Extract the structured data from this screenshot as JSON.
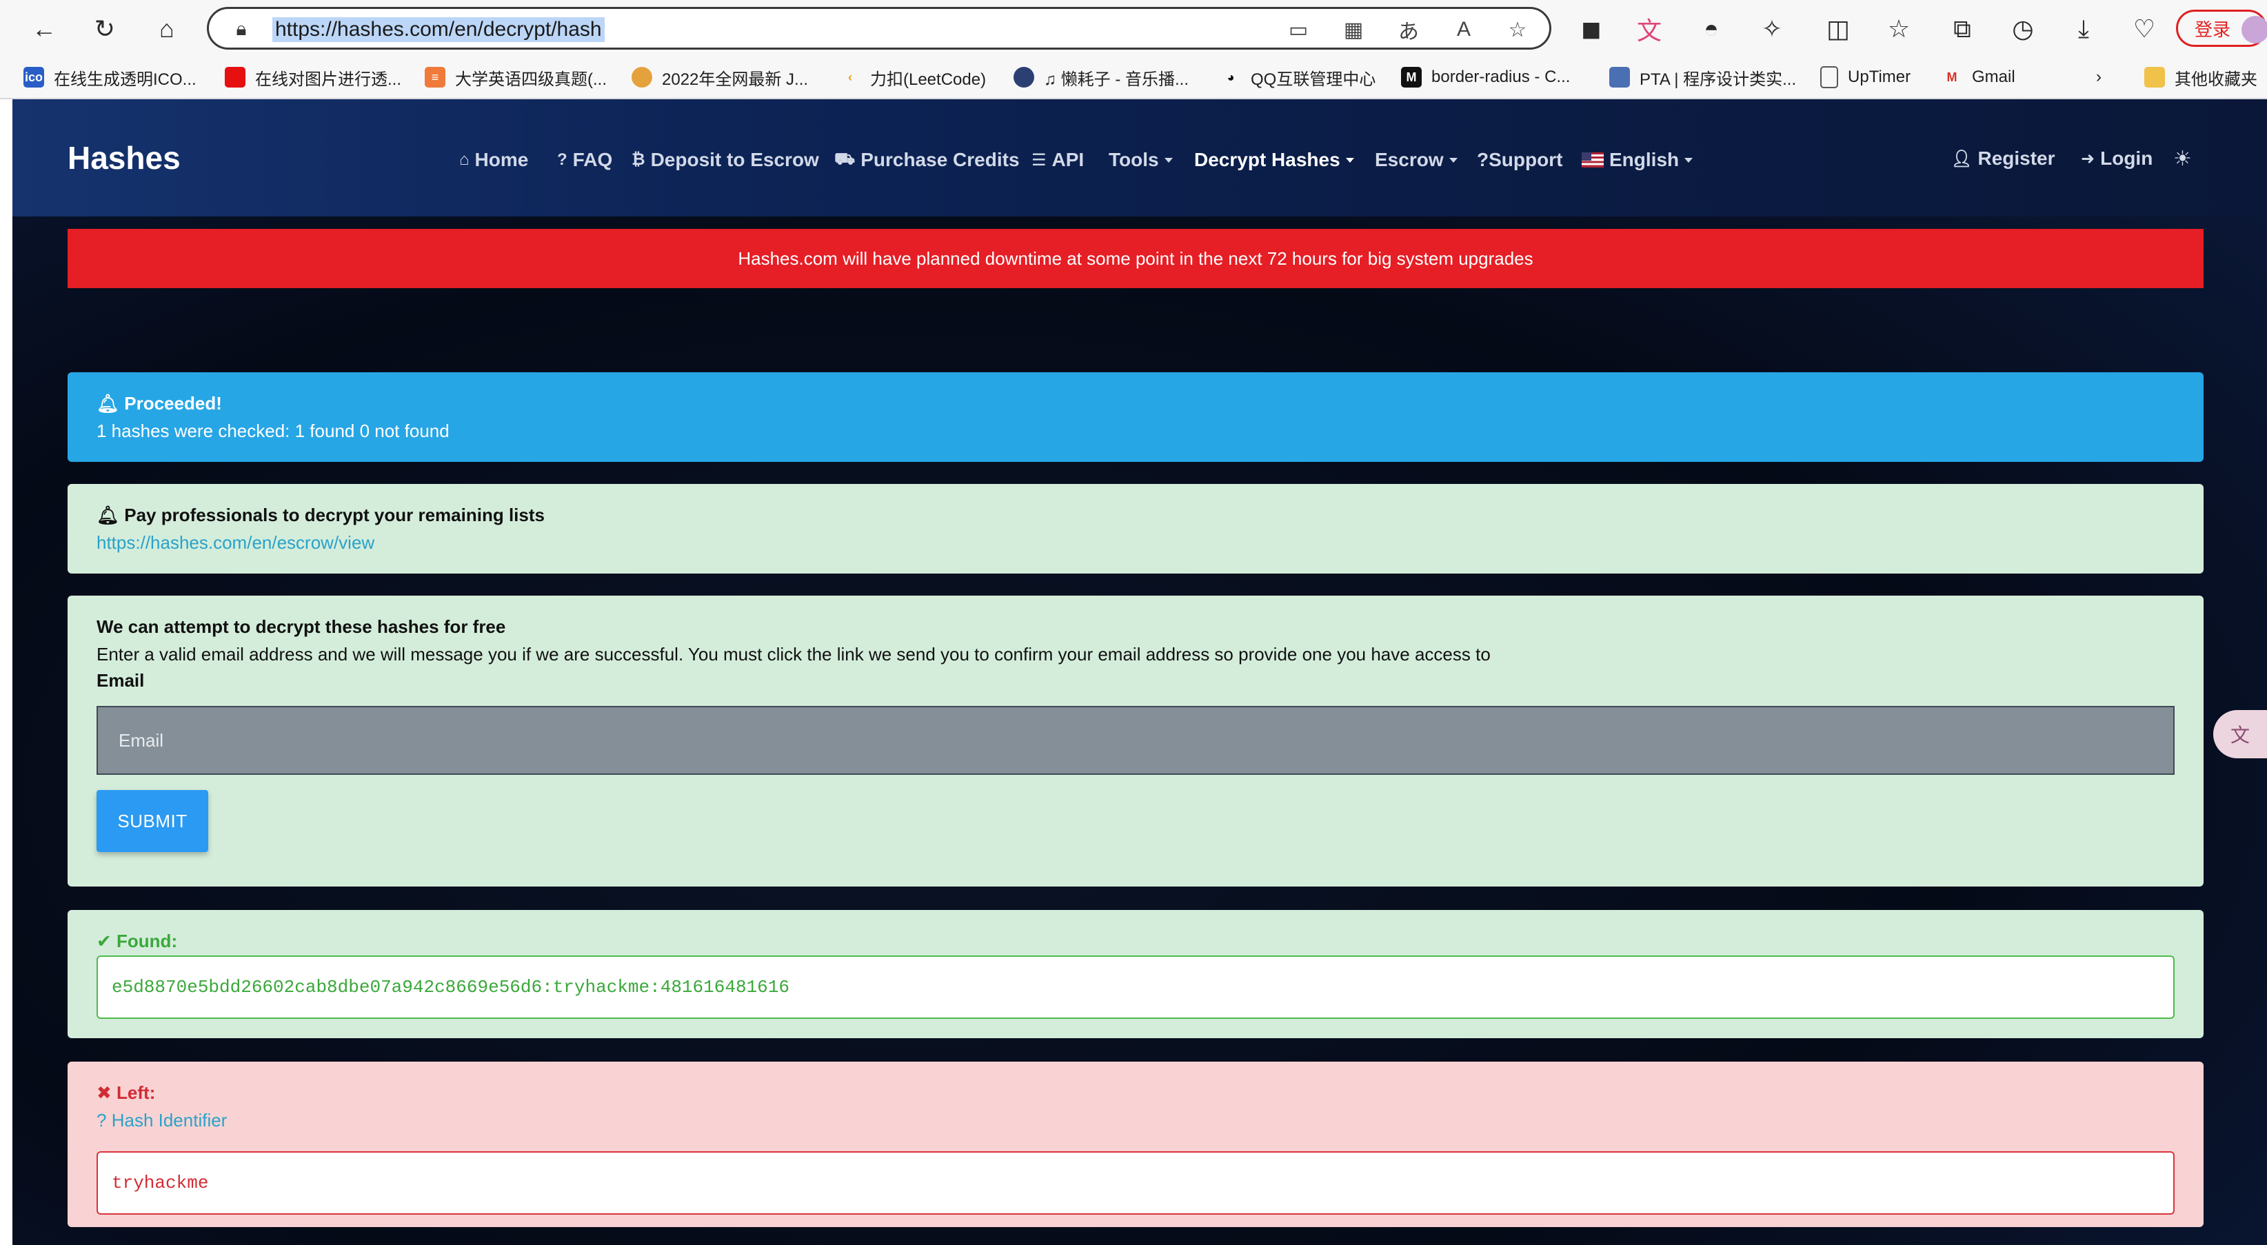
{
  "browser": {
    "url": "https://hashes.com/en/decrypt/hash",
    "login_label": "登录",
    "bookmarks": [
      {
        "label": "在线生成透明ICO...",
        "icon": "ico-icon"
      },
      {
        "label": "在线对图片进行透...",
        "icon": "red-square-icon"
      },
      {
        "label": "大学英语四级真题(...",
        "icon": "doc-orange-icon"
      },
      {
        "label": "2022年全网最新 J...",
        "icon": "avatar-icon"
      },
      {
        "label": "力扣(LeetCode)",
        "icon": "leetcode-icon"
      },
      {
        "label": "♫ 懒耗子 - 音乐播...",
        "icon": "music-icon"
      },
      {
        "label": "QQ互联管理中心",
        "icon": "qq-icon"
      },
      {
        "label": "border-radius - C...",
        "icon": "mdn-icon"
      },
      {
        "label": "PTA | 程序设计类实...",
        "icon": "pta-icon"
      },
      {
        "label": "UpTimer",
        "icon": "page-icon"
      },
      {
        "label": "Gmail",
        "icon": "gmail-icon"
      },
      {
        "label": "其他收藏夹",
        "icon": "folder-icon"
      }
    ]
  },
  "site": {
    "brand": "Hashes",
    "nav": {
      "home": "Home",
      "faq": "FAQ",
      "deposit": "Deposit to Escrow",
      "purchase": "Purchase Credits",
      "api": "API",
      "tools": "Tools",
      "decrypt": "Decrypt Hashes",
      "escrow": "Escrow",
      "support": "?Support",
      "language": "English",
      "register": "Register",
      "login": "Login"
    },
    "banner": "Hashes.com will have planned downtime at some point in the next 72 hours for big system upgrades",
    "proceeded": {
      "title": "Proceeded!",
      "text": "1 hashes were checked: 1 found 0 not found"
    },
    "pay": {
      "title": "Pay professionals to decrypt your remaining lists",
      "link": "https://hashes.com/en/escrow/view"
    },
    "free": {
      "title": "We can attempt to decrypt these hashes for free",
      "text": "Enter a valid email address and we will message you if we are successful. You must click the link we send you to confirm your email address so provide one you have access to",
      "email_label": "Email",
      "email_placeholder": "Email",
      "submit": "SUBMIT"
    },
    "found": {
      "title": "Found:",
      "value": "e5d8870e5bdd26602cab8dbe07a942c8669e56d6:tryhackme:481616481616"
    },
    "left": {
      "title": "Left:",
      "hash_identifier": "Hash Identifier",
      "value": "tryhackme"
    }
  },
  "colors": {
    "banner": "#e61e25",
    "info": "#27a6e5",
    "success_bg": "#d4eddb",
    "danger_bg": "#f9d3d3",
    "submit": "#2b9af2"
  }
}
